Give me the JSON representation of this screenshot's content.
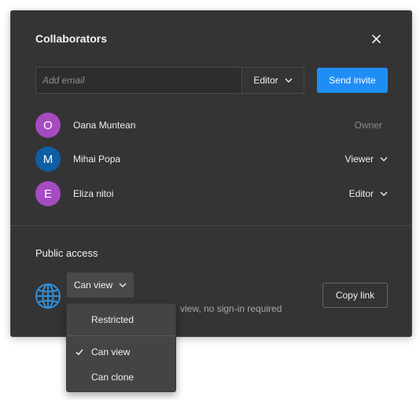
{
  "dialog": {
    "title": "Collaborators",
    "close_icon": "close-icon"
  },
  "invite": {
    "email_placeholder": "Add email",
    "email_value": "",
    "role_selected": "Editor",
    "send_label": "Send invite"
  },
  "collaborators": [
    {
      "initial": "O",
      "name": "Oana Muntean",
      "role": "Owner",
      "role_editable": false,
      "avatar_color": "#a64bc2"
    },
    {
      "initial": "M",
      "name": "Mihai Popa",
      "role": "Viewer",
      "role_editable": true,
      "avatar_color": "#0f5ea5"
    },
    {
      "initial": "E",
      "name": "Eliza nitoi",
      "role": "Editor",
      "role_editable": true,
      "avatar_color": "#a64bc2"
    }
  ],
  "public_access": {
    "title": "Public access",
    "icon": "globe-icon",
    "selected": "Can view",
    "description_visible": "view, no sign-in required",
    "copy_label": "Copy link"
  },
  "access_menu": {
    "items": [
      {
        "label": "Restricted",
        "checked": false
      },
      {
        "label": "Can view",
        "checked": true
      },
      {
        "label": "Can clone",
        "checked": false
      }
    ]
  },
  "colors": {
    "dialog_bg": "#353435",
    "accent": "#1f8ef4",
    "globe": "#2f8fd8"
  }
}
